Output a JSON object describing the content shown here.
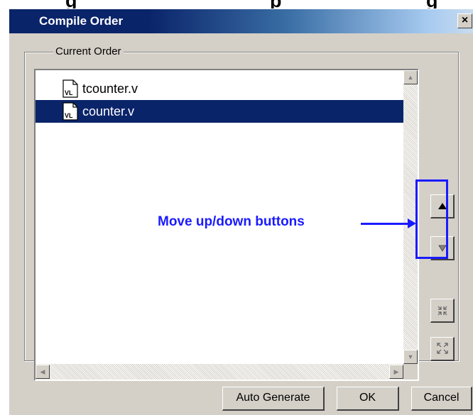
{
  "caption": {
    "segments": [
      "g",
      "p",
      "g"
    ]
  },
  "window": {
    "title": "Compile Order",
    "close_glyph": "×"
  },
  "group": {
    "label": "Current Order"
  },
  "file_list": {
    "items": [
      {
        "name": "tcounter.v",
        "icon": "verilog-file-icon",
        "icon_text": "VL",
        "selected": false
      },
      {
        "name": "counter.v",
        "icon": "verilog-file-icon",
        "icon_text": "VL",
        "selected": true
      }
    ]
  },
  "side_buttons": {
    "move_up": "move-up-icon",
    "move_down": "move-down-icon",
    "collapse": "collapse-icon",
    "expand": "expand-icon"
  },
  "annotation": {
    "text": "Move up/down buttons",
    "color": "#1a1aff"
  },
  "buttons": {
    "auto_generate": "Auto Generate",
    "ok": "OK",
    "cancel": "Cancel"
  },
  "colors": {
    "selection": "#0a246a",
    "dialog_bg": "#d4d0c8"
  }
}
